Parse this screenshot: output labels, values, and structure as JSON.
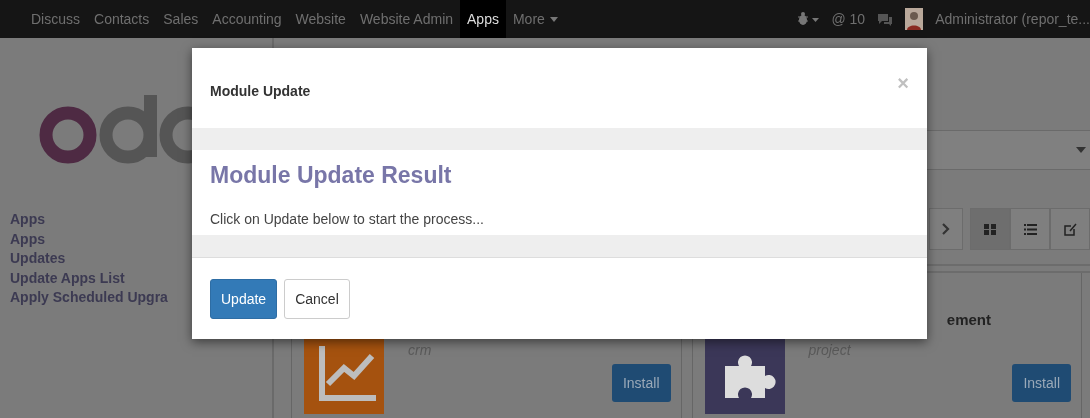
{
  "navbar": {
    "menu": [
      {
        "label": "Discuss",
        "selected": false,
        "dropdown": false
      },
      {
        "label": "Contacts",
        "selected": false,
        "dropdown": false
      },
      {
        "label": "Sales",
        "selected": false,
        "dropdown": false
      },
      {
        "label": "Accounting",
        "selected": false,
        "dropdown": false
      },
      {
        "label": "Website",
        "selected": false,
        "dropdown": false
      },
      {
        "label": "Website Admin",
        "selected": false,
        "dropdown": false
      },
      {
        "label": "Apps",
        "selected": true,
        "dropdown": false
      },
      {
        "label": "More",
        "selected": false,
        "dropdown": true
      }
    ],
    "mentions": "@ 10",
    "user": "Administrator (repor_te..."
  },
  "sidebar": {
    "section": "Apps",
    "items": [
      "Apps",
      "Updates",
      "Update Apps List",
      "Apply Scheduled Upgra"
    ]
  },
  "views": [
    {
      "kind": "kanban",
      "selected": true
    },
    {
      "kind": "list",
      "selected": false
    },
    {
      "kind": "form",
      "selected": false
    }
  ],
  "cards": [
    {
      "module": "crm",
      "kind": "chart",
      "color": "#a5520f",
      "button": "Install"
    },
    {
      "title": "ement",
      "module": "project",
      "kind": "puzzle",
      "color": "#3b3758",
      "button": "Install"
    }
  ],
  "modal": {
    "title": "Module Update",
    "close": "×",
    "heading": "Module Update Result",
    "message": "Click on Update below to start the process...",
    "buttons": [
      {
        "label": "Update",
        "kind": "primary"
      },
      {
        "label": "Cancel",
        "kind": "default"
      }
    ]
  }
}
